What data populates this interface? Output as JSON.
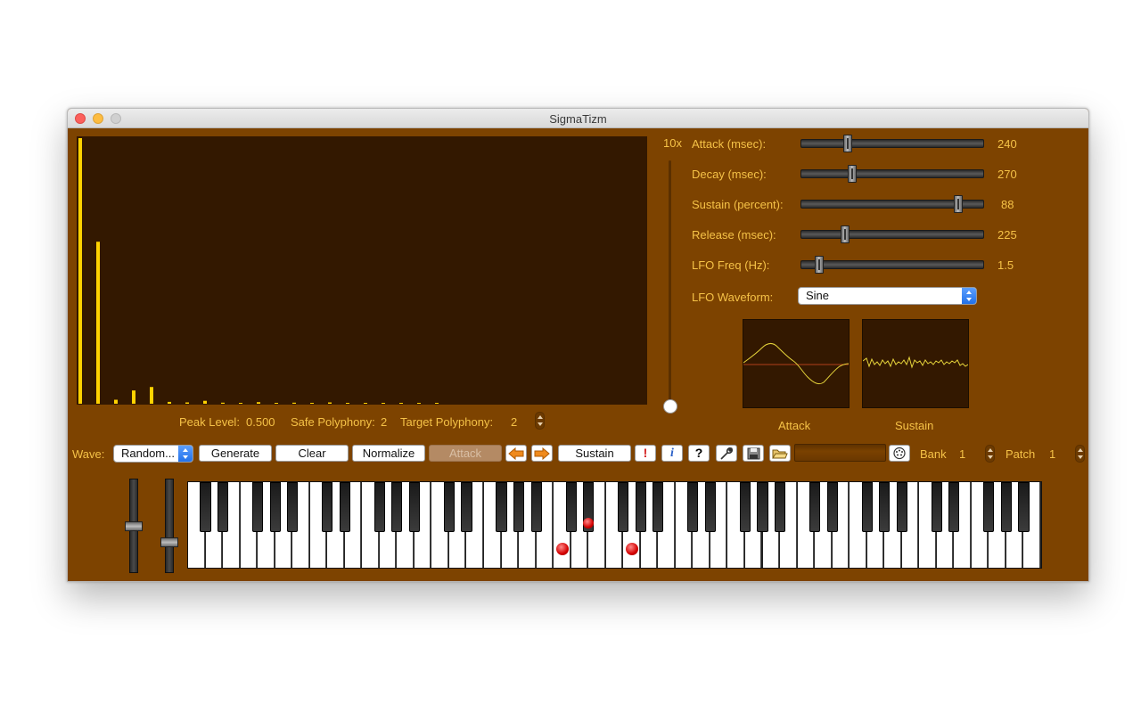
{
  "window": {
    "title": "SigmaTizm"
  },
  "spectrum": {
    "scale_label": "10x",
    "bar_color": "#ffd200",
    "bars": [
      1.0,
      0.61,
      0.015,
      0.05,
      0.063,
      0.007,
      0.005,
      0.011,
      0.004,
      0.003,
      0.006,
      0.003,
      0.004,
      0.002,
      0.005,
      0.003,
      0.002,
      0.003,
      0.002,
      0.002,
      0.001
    ],
    "scale_slider_value": 0.0
  },
  "status": {
    "peak_label": "Peak Level:",
    "peak_value": "0.500",
    "safe_poly_label": "Safe Polyphony:",
    "safe_poly_value": "2",
    "target_poly_label": "Target Polyphony:",
    "target_poly_value": "2"
  },
  "envelope": {
    "attack": {
      "label": "Attack (msec):",
      "value": "240",
      "position": 0.24
    },
    "decay": {
      "label": "Decay (msec):",
      "value": "270",
      "position": 0.27
    },
    "sustain": {
      "label": "Sustain (percent):",
      "value": "88",
      "position": 0.88
    },
    "release": {
      "label": "Release (msec):",
      "value": "225",
      "position": 0.225
    },
    "lfo_freq": {
      "label": "LFO Freq (Hz):",
      "value": "1.5",
      "position": 0.075
    },
    "lfo_waveform_label": "LFO Waveform:",
    "lfo_waveform_value": "Sine"
  },
  "previews": {
    "attack_label": "Attack",
    "sustain_label": "Sustain",
    "trace_color": "#e6d43a"
  },
  "toolbar": {
    "wave_label": "Wave:",
    "wave_value": "Random...",
    "generate": "Generate",
    "clear": "Clear",
    "normalize": "Normalize",
    "attack": "Attack",
    "sustain": "Sustain",
    "bank_label": "Bank",
    "bank_value": "1",
    "patch_label": "Patch",
    "patch_value": "1",
    "icons": [
      "arrow-left-icon",
      "arrow-right-icon",
      "exclamation-icon",
      "info-icon",
      "help-icon",
      "wrench-icon",
      "save-icon",
      "folder-open-icon",
      "midi-icon"
    ]
  },
  "keyboard": {
    "white_keys": 49,
    "pressed_white": [
      21,
      25
    ],
    "pressed_black": [
      [
        22,
        23
      ]
    ],
    "faders": {
      "pitch_bend": 0.5,
      "modulation": 0.7
    }
  }
}
